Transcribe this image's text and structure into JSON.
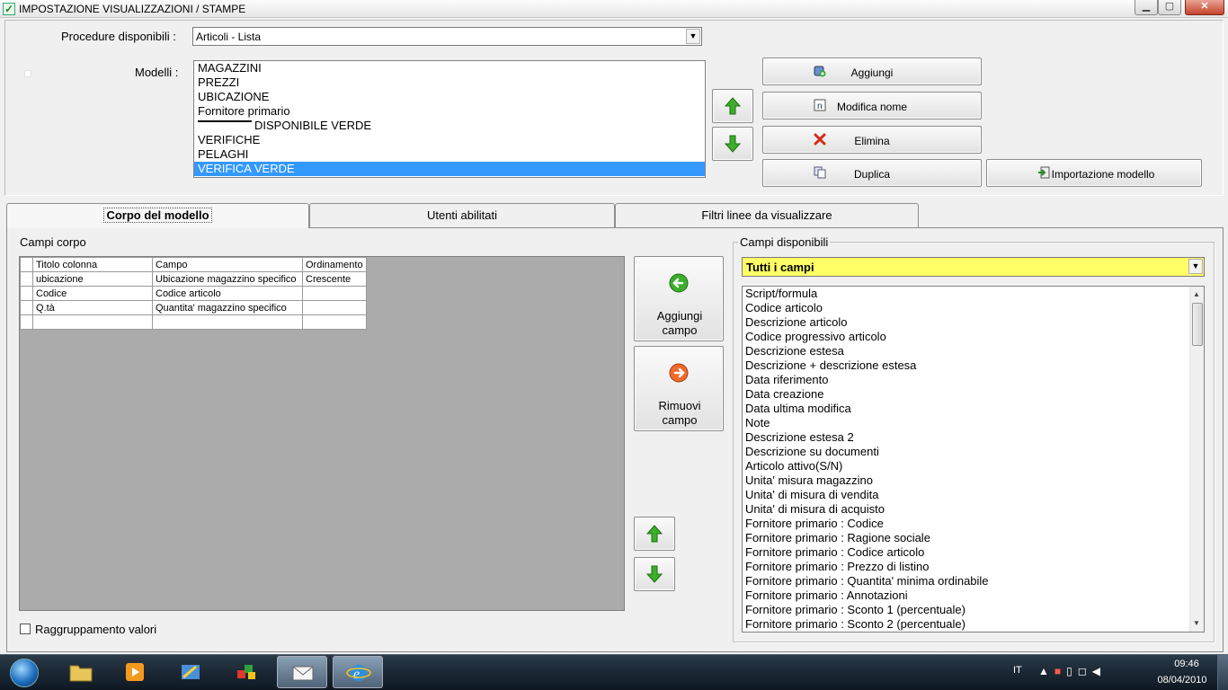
{
  "window": {
    "title": "IMPOSTAZIONE VISUALIZZAZIONI / STAMPE",
    "min_symbol": "▁",
    "max_symbol": "▢",
    "close_symbol": "✕"
  },
  "top": {
    "procedure_label": "Procedure disponibili :",
    "procedure_value": "Articoli - Lista",
    "models_label": "Modelli :",
    "models": [
      "MAGAZZINI",
      "PREZZI",
      "UBICAZIONE",
      "Fornitore primario",
      "DISPONIBILE VERDE",
      "VERIFICHE",
      "PELAGHI",
      "VERIFICA VERDE"
    ],
    "selected_model_index": 7,
    "buttons": {
      "aggiungi": "Aggiungi",
      "modifica_nome": "Modifica nome",
      "elimina": "Elimina",
      "duplica": "Duplica",
      "importazione": "Importazione modello"
    }
  },
  "tabs": [
    "Corpo del modello",
    "Utenti abilitati",
    "Filtri linee da visualizzare"
  ],
  "active_tab": 0,
  "corpo": {
    "label": "Campi corpo",
    "columns": [
      "Titolo colonna",
      "Campo",
      "Ordinamento"
    ],
    "rows": [
      [
        "ubicazione",
        "Ubicazione magazzino specifico",
        "Crescente"
      ],
      [
        "Codice",
        "Codice articolo",
        ""
      ],
      [
        "Q.tà",
        "Quantita' magazzino specifico",
        ""
      ],
      [
        "",
        "",
        ""
      ]
    ],
    "add_field": "Aggiungi campo",
    "remove_field": "Rimuovi campo",
    "group_values_label": "Raggruppamento valori"
  },
  "disponibili": {
    "label": "Campi disponibili",
    "filter_value": "Tutti i campi",
    "items": [
      "Script/formula",
      "Codice articolo",
      "Descrizione articolo",
      "Codice progressivo articolo",
      "Descrizione estesa",
      "Descrizione + descrizione estesa",
      "Data riferimento",
      "Data creazione",
      "Data ultima modifica",
      "Note",
      "Descrizione estesa 2",
      "Descrizione su documenti",
      "Articolo attivo(S/N)",
      "Unita' misura magazzino",
      "Unita' di misura di vendita",
      "Unita' di misura di acquisto",
      "Fornitore primario : Codice",
      "Fornitore primario : Ragione sociale",
      "Fornitore primario : Codice articolo",
      "Fornitore primario : Prezzo di listino",
      "Fornitore primario : Quantita' minima ordinabile",
      "Fornitore primario : Annotazioni",
      "Fornitore primario : Sconto 1 (percentuale)",
      "Fornitore primario : Sconto 2 (percentuale)"
    ]
  },
  "taskbar": {
    "language": "IT",
    "time": "09:46",
    "date": "08/04/2010"
  },
  "colors": {
    "selection": "#3399ff",
    "filter_bg": "#ffff66",
    "grid_area": "#ababab",
    "arrow_green": "#3cae2a"
  }
}
